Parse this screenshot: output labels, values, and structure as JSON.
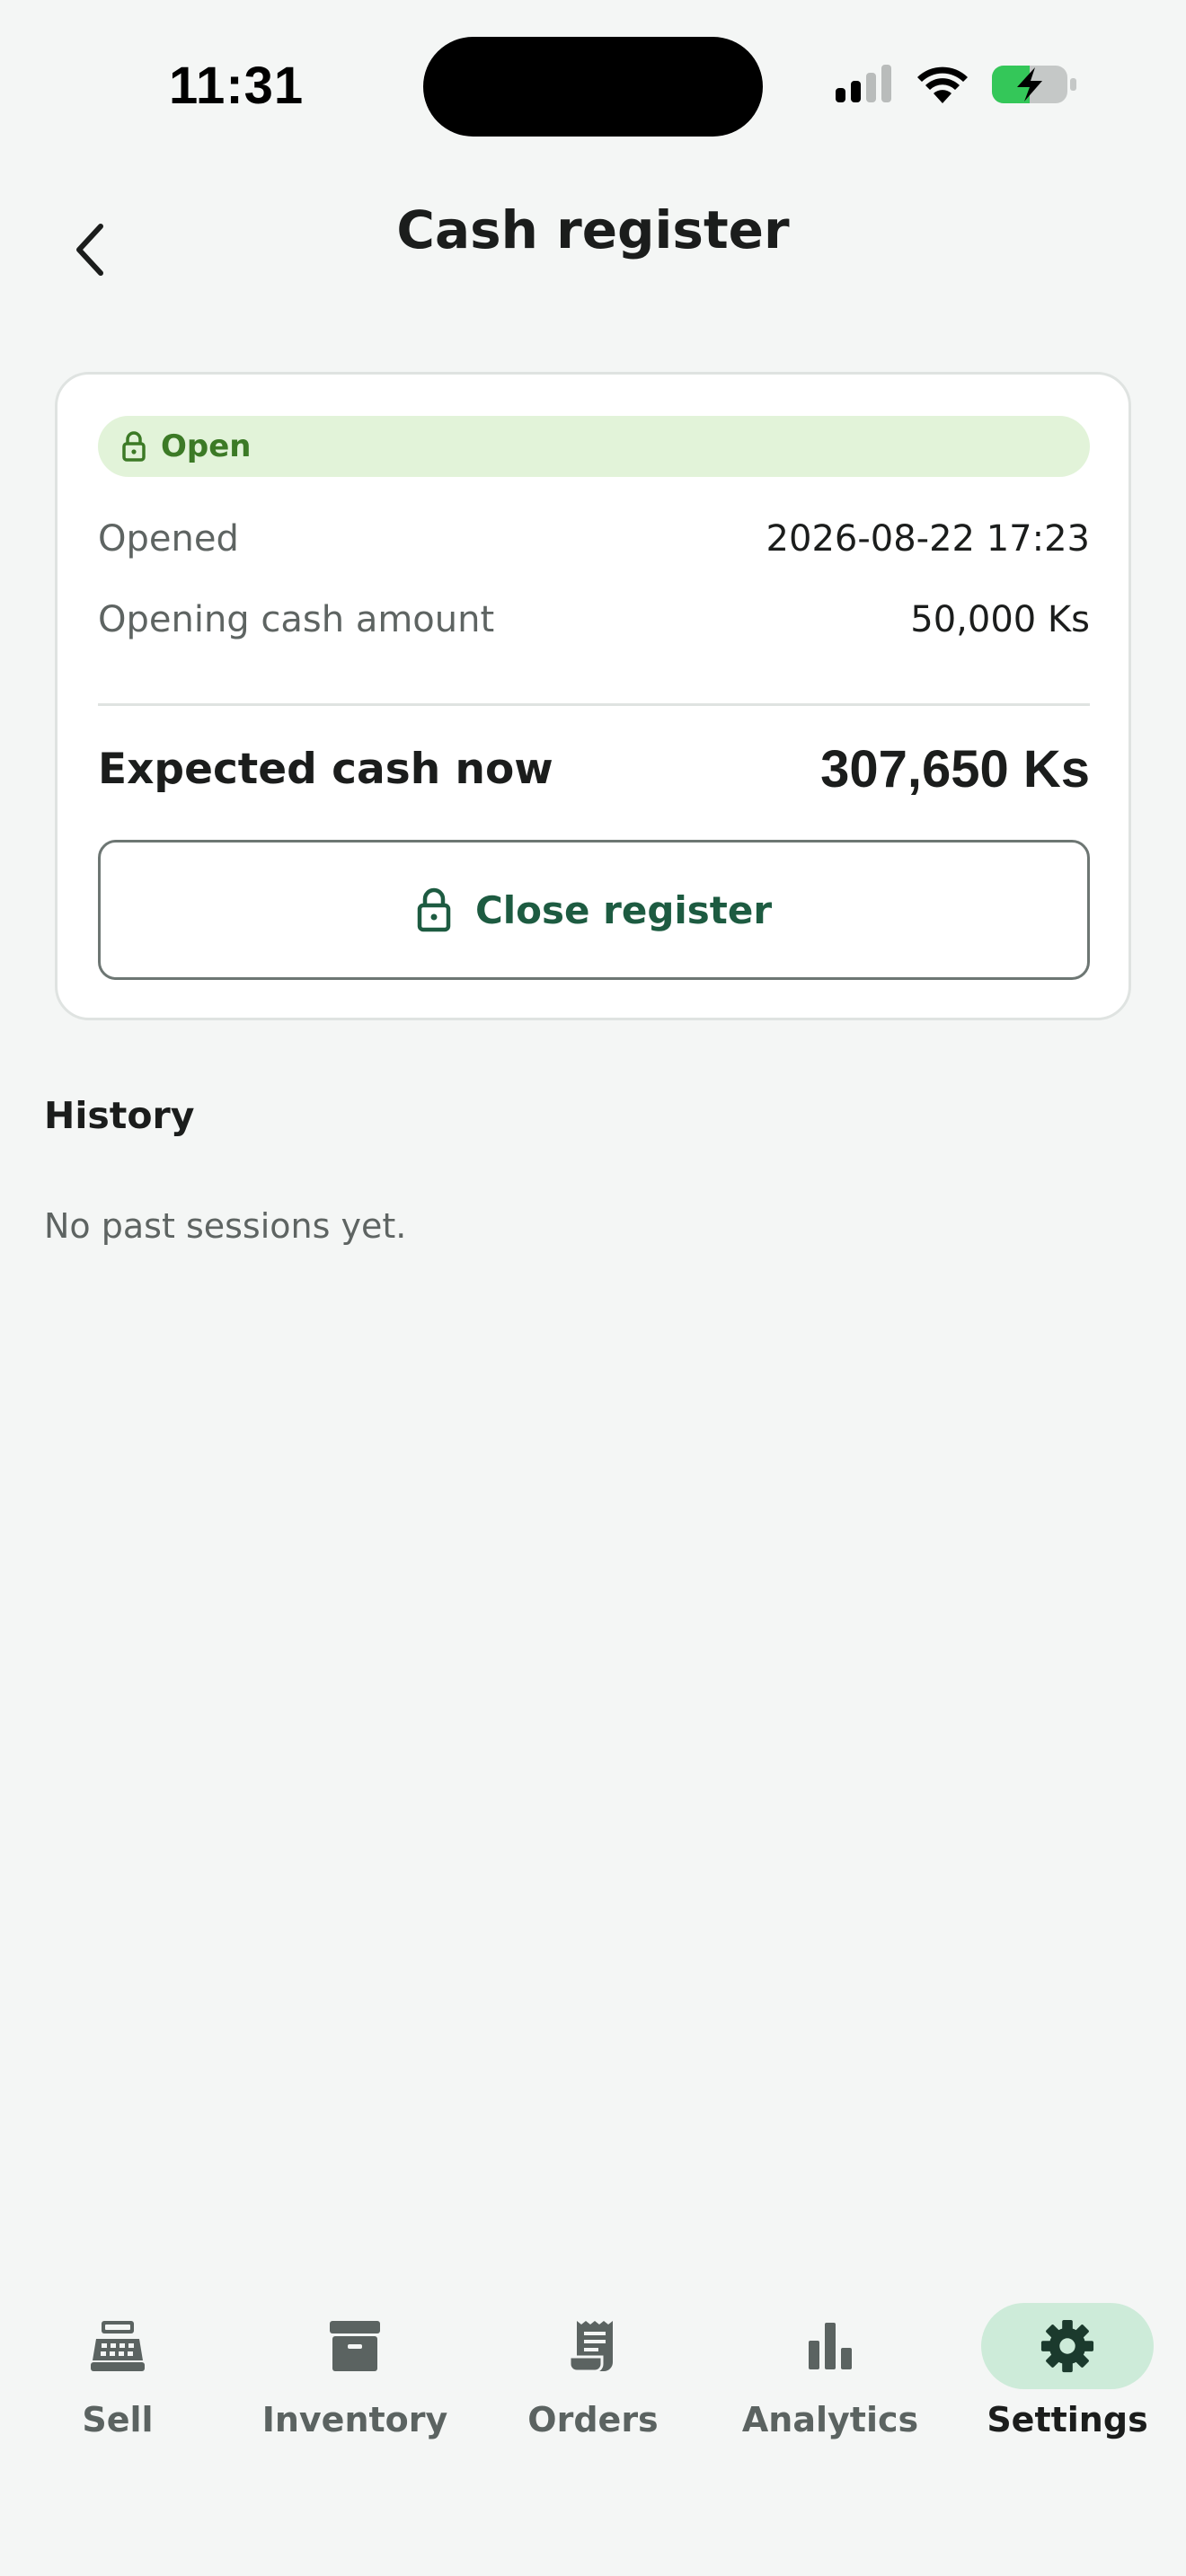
{
  "status_bar": {
    "time": "11:31"
  },
  "header": {
    "title": "Cash register",
    "back_icon": "chevron-left-icon"
  },
  "register": {
    "status_label": "Open",
    "status_icon": "lock-open-icon",
    "opened_label": "Opened",
    "opened_value": "2026-08-22 17:23",
    "opening_cash_label": "Opening cash amount",
    "opening_cash_value": "50,000 Ks",
    "expected_label": "Expected cash now",
    "expected_value": "307,650 Ks",
    "close_button_label": "Close register",
    "close_button_icon": "lock-icon"
  },
  "history": {
    "title": "History",
    "empty_text": "No past sessions yet."
  },
  "nav": {
    "items": [
      {
        "label": "Sell",
        "icon": "cash-register-icon",
        "active": false
      },
      {
        "label": "Inventory",
        "icon": "archive-box-icon",
        "active": false
      },
      {
        "label": "Orders",
        "icon": "receipt-icon",
        "active": false
      },
      {
        "label": "Analytics",
        "icon": "bar-chart-icon",
        "active": false
      },
      {
        "label": "Settings",
        "icon": "gear-icon",
        "active": true
      }
    ]
  },
  "colors": {
    "accent": "#1d5b41",
    "open_badge_bg": "#e2f3d9",
    "open_badge_text": "#3c7a26",
    "active_nav_bg": "#cdebd9"
  }
}
